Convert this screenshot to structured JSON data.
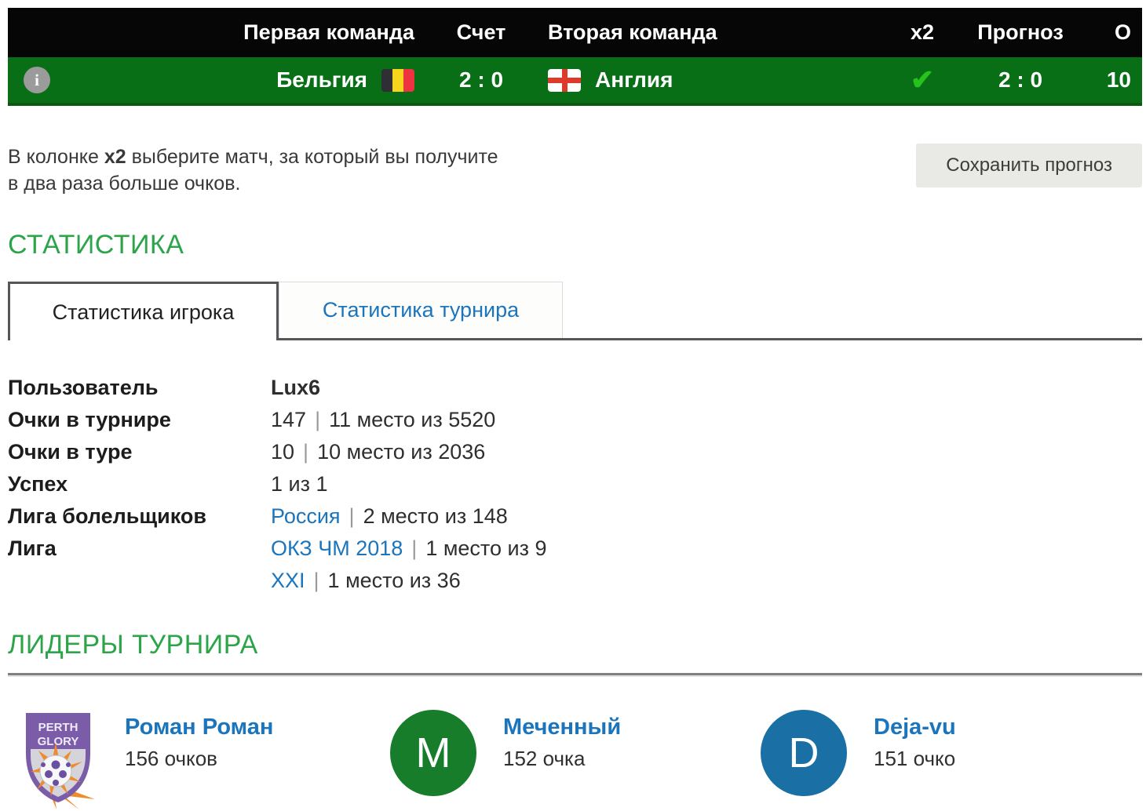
{
  "colors": {
    "row_green": "#096f17",
    "check_green": "#27c31d",
    "heading_green": "#2ca44a",
    "link_blue": "#1b75bc",
    "avatar_green": "#177d2a",
    "avatar_blue": "#1a6fa5"
  },
  "match_table": {
    "headers": {
      "first_team": "Первая команда",
      "score": "Счет",
      "second_team": "Вторая команда",
      "x2": "x2",
      "forecast": "Прогноз",
      "points": "О"
    },
    "row": {
      "info_icon": "i",
      "first_team": "Бельгия",
      "first_team_flag": "belgium-flag",
      "score": "2 : 0",
      "second_team": "Англия",
      "second_team_flag": "england-flag",
      "x2_check": "✔",
      "forecast": "2 : 0",
      "points": "10"
    }
  },
  "hint": {
    "line1_pre": "В колонке ",
    "line1_bold": "x2",
    "line1_post": " выберите матч, за который вы получите",
    "line2": "в два раза больше очков.",
    "save_button": "Сохранить прогноз"
  },
  "stats": {
    "title": "СТАТИСТИКА",
    "tabs": [
      {
        "label": "Статистика игрока"
      },
      {
        "label": "Статистика турнира"
      }
    ],
    "rows": {
      "user": {
        "label": "Пользователь",
        "value": "Lux6"
      },
      "tournament_points": {
        "label": "Очки в турнире",
        "value": "147",
        "sep": "|",
        "detail": "11 место из 5520"
      },
      "round_points": {
        "label": "Очки в туре",
        "value": "10",
        "sep": "|",
        "detail": "10 место из 2036"
      },
      "success": {
        "label": "Успех",
        "value": "1 из 1"
      },
      "fan_league": {
        "label": "Лига болельщиков",
        "link": "Россия",
        "sep": "|",
        "detail": "2 место из 148"
      },
      "league": {
        "label": "Лига",
        "line1": {
          "link": "ОКЗ ЧМ 2018",
          "sep": "|",
          "detail": "1 место из 9"
        },
        "line2": {
          "link": "XXI",
          "sep": "|",
          "detail": "1 место из 36"
        }
      }
    }
  },
  "leaders": {
    "title": "ЛИДЕРЫ ТУРНИРА",
    "items": [
      {
        "name": "Роман Роман",
        "points": "156 очков",
        "crest_line1": "PERTH",
        "crest_line2": "GLORY"
      },
      {
        "name": "Меченный",
        "points": "152 очка",
        "initial": "M",
        "color": "#177d2a"
      },
      {
        "name": "Deja-vu",
        "points": "151 очко",
        "initial": "D",
        "color": "#1a6fa5"
      }
    ]
  }
}
